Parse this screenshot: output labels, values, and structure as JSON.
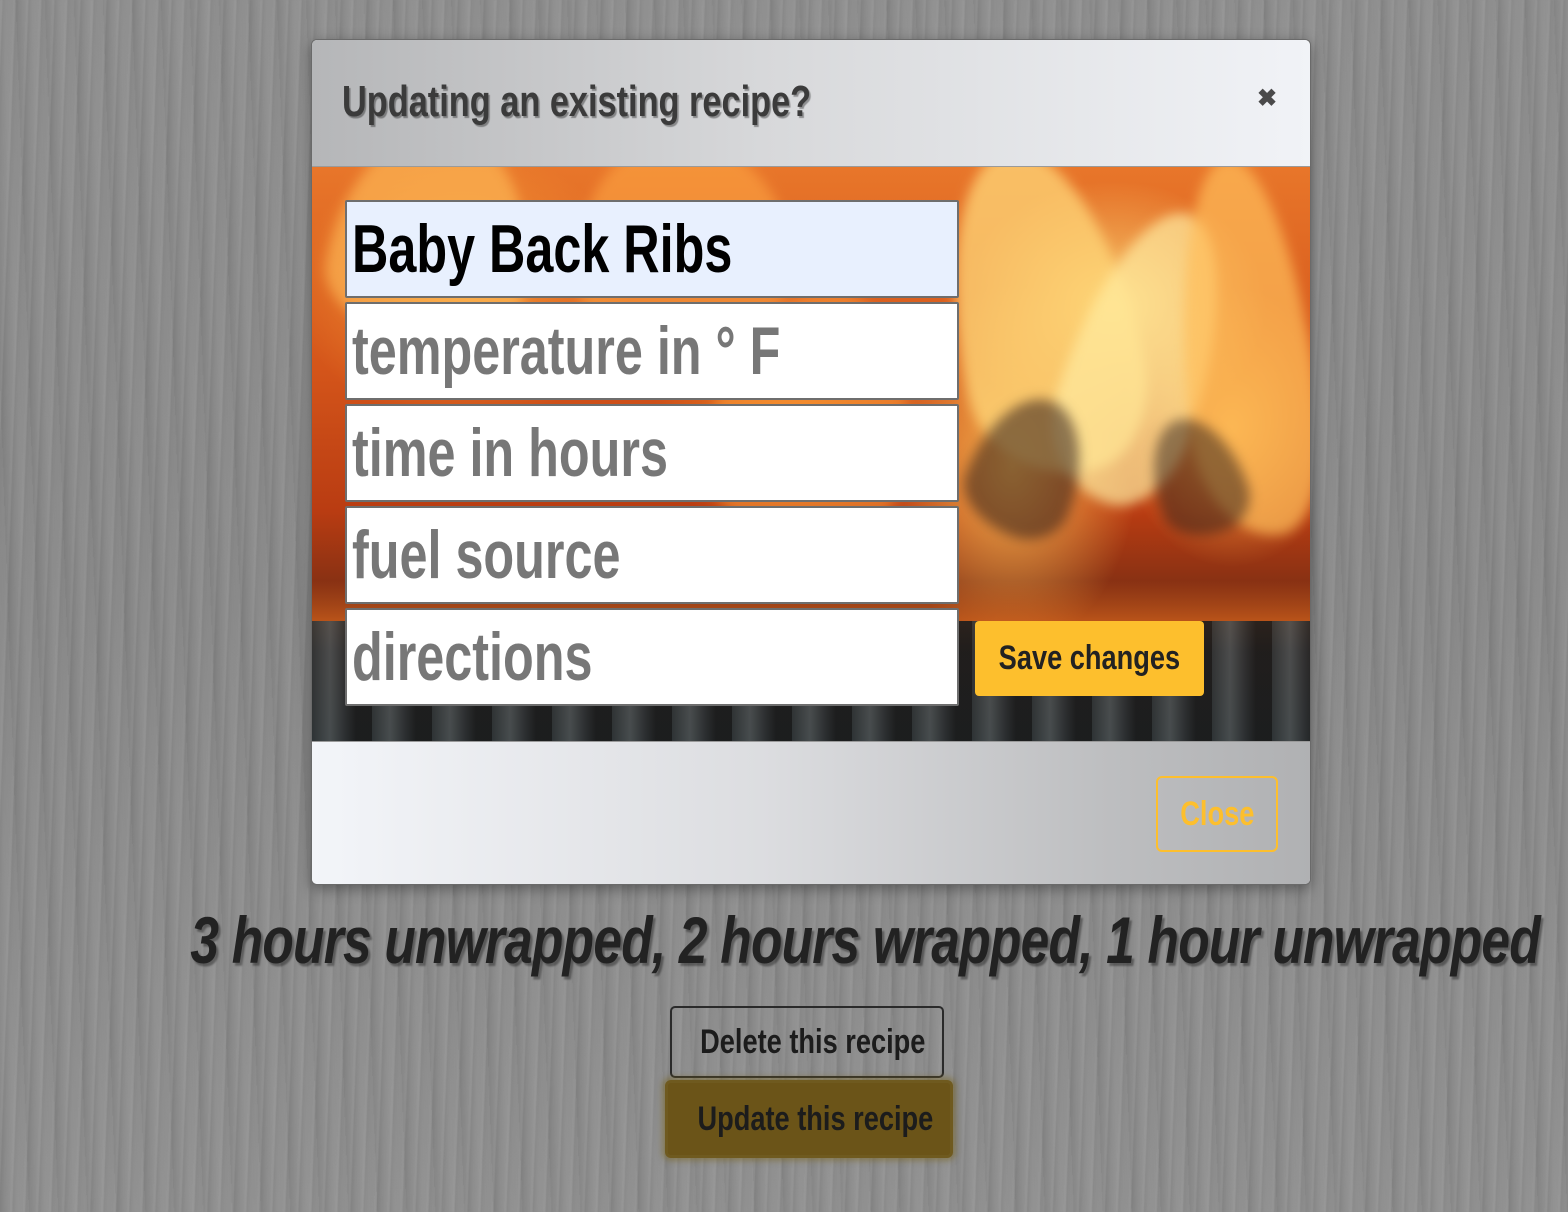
{
  "page": {
    "directions_text": "3 hours unwrapped, 2 hours wrapped, 1 hour unwrapped",
    "delete_label": "Delete this recipe",
    "update_label": "Update this recipe"
  },
  "modal": {
    "title": "Updating an existing recipe?",
    "close_icon_glyph": "✖",
    "fields": {
      "name": {
        "value": "Baby Back Ribs",
        "placeholder": ""
      },
      "temperature": {
        "value": "",
        "placeholder": "temperature in ° F"
      },
      "time": {
        "value": "",
        "placeholder": "time in hours"
      },
      "fuel": {
        "value": "",
        "placeholder": "fuel source"
      },
      "directions": {
        "value": "",
        "placeholder": "directions"
      }
    },
    "save_label": "Save changes",
    "close_label": "Close",
    "background_image": "flames-on-grill"
  },
  "colors": {
    "accent": "#fdbf2d",
    "update_button": "#6b5418",
    "autofill_field": "#e8f0fe"
  }
}
